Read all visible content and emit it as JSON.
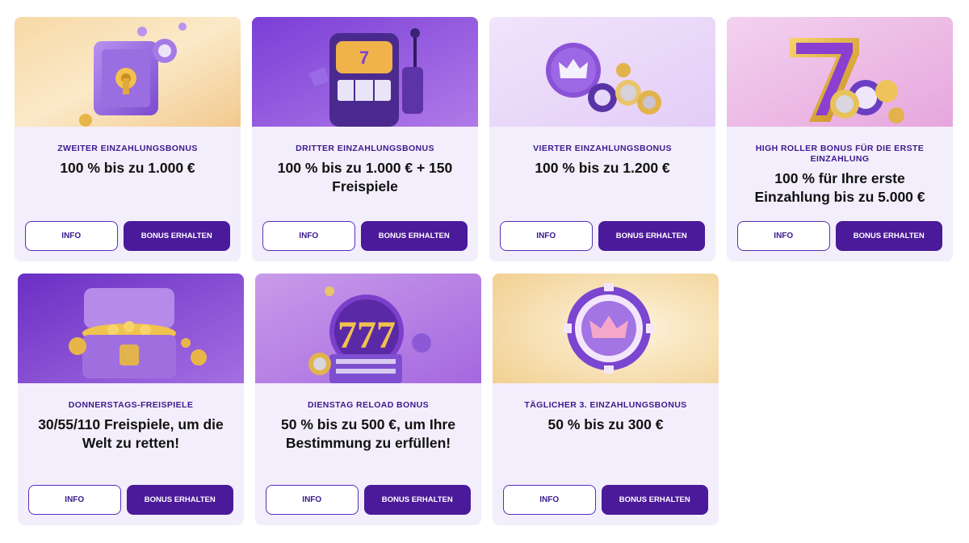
{
  "cards": [
    {
      "kicker": "ZWEITER EINZAHLUNGSBONUS",
      "headline": "100 % bis zu 1.000 €",
      "info_label": "INFO",
      "bonus_label": "BONUS ERHALTEN"
    },
    {
      "kicker": "DRITTER EINZAHLUNGSBONUS",
      "headline": "100 % bis zu 1.000 € + 150 Freispiele",
      "info_label": "INFO",
      "bonus_label": "BONUS ERHALTEN"
    },
    {
      "kicker": "VIERTER EINZAHLUNGSBONUS",
      "headline": "100 % bis zu 1.200 €",
      "info_label": "INFO",
      "bonus_label": "BONUS ERHALTEN"
    },
    {
      "kicker": "HIGH ROLLER BONUS FÜR DIE ERSTE EINZAHLUNG",
      "headline": "100 % für Ihre erste Einzahlung bis zu 5.000 €",
      "info_label": "INFO",
      "bonus_label": "BONUS ERHALTEN"
    },
    {
      "kicker": "DONNERSTAGS-FREISPIELE",
      "headline": "30/55/110 Freispiele, um die Welt zu retten!",
      "info_label": "INFO",
      "bonus_label": "BONUS ERHALTEN"
    },
    {
      "kicker": "DIENSTAG RELOAD BONUS",
      "headline": "50 % bis zu 500 €, um Ihre Bestimmung zu erfüllen!",
      "info_label": "INFO",
      "bonus_label": "BONUS ERHALTEN"
    },
    {
      "kicker": "TÄGLICHER 3. EINZAHLUNGSBONUS",
      "headline": "50 % bis zu 300 €",
      "info_label": "INFO",
      "bonus_label": "BONUS ERHALTEN"
    }
  ],
  "banner_icons": [
    "safe-icon",
    "slot-machine-icon",
    "crown-chip-icon",
    "lucky-seven-icon",
    "treasure-chest-icon",
    "triple-seven-icon",
    "poker-chip-icon"
  ],
  "colors": {
    "card_bg": "#f3eefb",
    "button_primary": "#4b1a9a",
    "kicker_text": "#3b1a8c"
  }
}
